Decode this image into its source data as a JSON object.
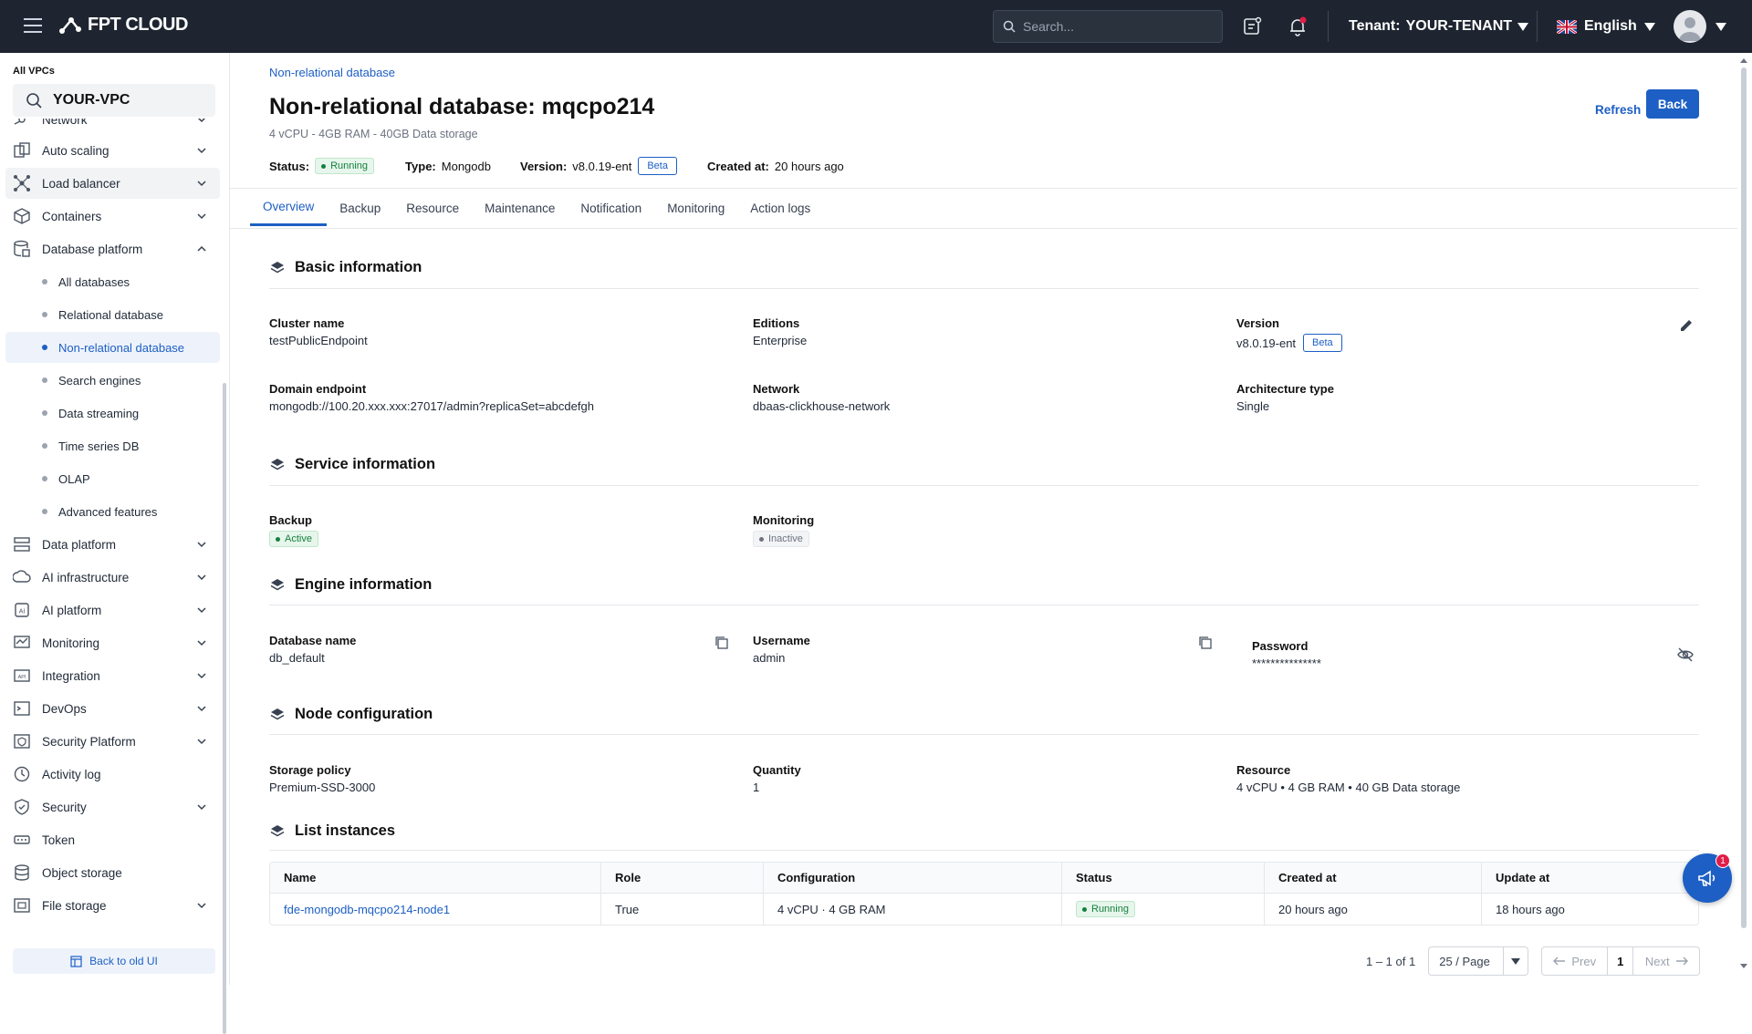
{
  "topbar": {
    "brand": "FPT CLOUD",
    "search_placeholder": "Search...",
    "tenant_label": "Tenant:",
    "tenant_value": "YOUR-TENANT",
    "language": "English"
  },
  "sidebar": {
    "vpc_label": "All VPCs",
    "vpc_value": "YOUR-VPC",
    "items": [
      {
        "label": "Network",
        "icon": "network-icon"
      },
      {
        "label": "Auto scaling",
        "icon": "autoscaling-icon"
      },
      {
        "label": "Load balancer",
        "icon": "load-balancer-icon"
      },
      {
        "label": "Containers",
        "icon": "containers-icon"
      },
      {
        "label": "Database platform",
        "icon": "database-icon"
      },
      {
        "label": "Data platform",
        "icon": "data-platform-icon"
      },
      {
        "label": "AI infrastructure",
        "icon": "ai-infra-icon"
      },
      {
        "label": "AI platform",
        "icon": "ai-platform-icon"
      },
      {
        "label": "Monitoring",
        "icon": "monitoring-icon"
      },
      {
        "label": "Integration",
        "icon": "integration-icon"
      },
      {
        "label": "DevOps",
        "icon": "devops-icon"
      },
      {
        "label": "Security Platform",
        "icon": "security-platform-icon"
      },
      {
        "label": "Activity log",
        "icon": "activity-log-icon"
      },
      {
        "label": "Security",
        "icon": "security-icon"
      },
      {
        "label": "Token",
        "icon": "token-icon"
      },
      {
        "label": "Object storage",
        "icon": "object-storage-icon"
      },
      {
        "label": "File storage",
        "icon": "file-storage-icon"
      }
    ],
    "db_sub": [
      "All databases",
      "Relational database",
      "Non-relational database",
      "Search engines",
      "Data streaming",
      "Time series DB",
      "OLAP",
      "Advanced features"
    ],
    "back_old_ui": "Back to old UI"
  },
  "header": {
    "breadcrumb": "Non-relational database",
    "title": "Non-relational database: mqcpo214",
    "specs": "4 vCPU - 4GB RAM - 40GB Data storage",
    "status_label": "Status:",
    "status_value": "Running",
    "type_label": "Type:",
    "type_value": "Mongodb",
    "version_label": "Version:",
    "version_value": "v8.0.19-ent",
    "beta": "Beta",
    "created_label": "Created at:",
    "created_value": "20 hours ago",
    "refresh": "Refresh",
    "back": "Back"
  },
  "tabs": [
    "Overview",
    "Backup",
    "Resource",
    "Maintenance",
    "Notification",
    "Monitoring",
    "Action logs"
  ],
  "basic": {
    "title": "Basic information",
    "cluster_label": "Cluster name",
    "cluster_value": "testPublicEndpoint",
    "editions_label": "Editions",
    "editions_value": "Enterprise",
    "version_label": "Version",
    "version_value": "v8.0.19-ent",
    "version_badge": "Beta",
    "domain_label": "Domain endpoint",
    "domain_value": "mongodb://100.20.xxx.xxx:27017/admin?replicaSet=abcdefgh",
    "network_label": "Network",
    "network_value": "dbaas-clickhouse-network",
    "arch_label": "Architecture type",
    "arch_value": "Single"
  },
  "service": {
    "title": "Service information",
    "backup_label": "Backup",
    "backup_value": "Active",
    "monitoring_label": "Monitoring",
    "monitoring_value": "Inactive"
  },
  "engine": {
    "title": "Engine information",
    "dbname_label": "Database name",
    "dbname_value": "db_default",
    "username_label": "Username",
    "username_value": "admin",
    "password_label": "Password",
    "password_value": "***************"
  },
  "node": {
    "title": "Node configuration",
    "storage_label": "Storage policy",
    "storage_value": "Premium-SSD-3000",
    "quantity_label": "Quantity",
    "quantity_value": "1",
    "resource_label": "Resource",
    "resource_value": "4 vCPU • 4 GB RAM • 40 GB Data storage"
  },
  "instances": {
    "title": "List instances",
    "columns": [
      "Name",
      "Role",
      "Configuration",
      "Status",
      "Created at",
      "Update at"
    ],
    "rows": [
      {
        "name": "fde-mongodb-mqcpo214-node1",
        "role": "True",
        "config": "4 vCPU · 4 GB RAM",
        "status": "Running",
        "created": "20 hours ago",
        "updated": "18 hours ago"
      }
    ],
    "range": "1 – 1 of 1",
    "page_size": "25 / Page",
    "prev": "Prev",
    "page": "1",
    "next": "Next"
  },
  "fab_count": "1",
  "colors": {
    "accent": "#1d5fc4",
    "topbar": "#1e2530",
    "running": "#15803d"
  }
}
